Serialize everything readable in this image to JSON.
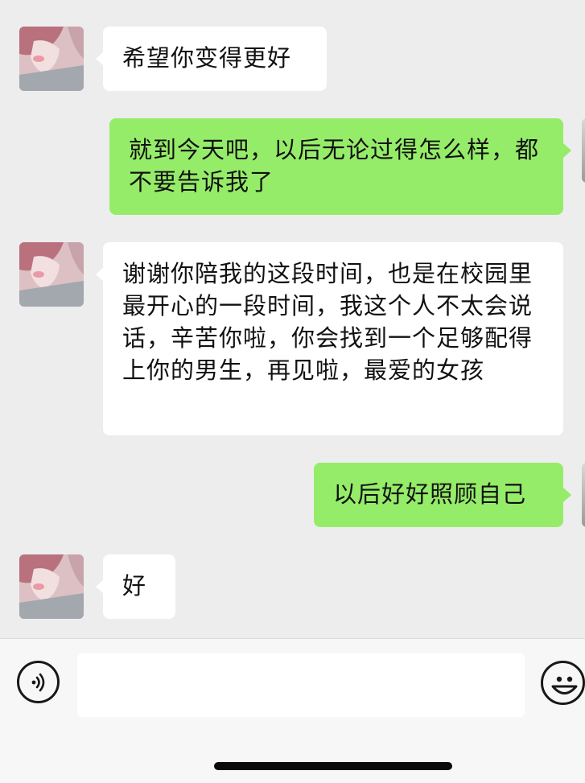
{
  "messages": [
    {
      "side": "received",
      "text": "希望你变得更好"
    },
    {
      "side": "sent",
      "text": "就到今天吧，以后无论过得怎么样，都不要告诉我了"
    },
    {
      "side": "received",
      "text": "谢谢你陪我的这段时间，也是在校园里最开心的一段时间，我这个人不太会说话，辛苦你啦，你会找到一个足够配得上你的男生，再见啦，最爱的女孩"
    },
    {
      "side": "sent",
      "text": "以后好好照顾自己"
    },
    {
      "side": "received",
      "text": "好"
    }
  ],
  "input_bar": {
    "text_value": "",
    "left_icon": "voice-icon",
    "right_icon": "emoji-icon"
  },
  "colors": {
    "background": "#ededed",
    "sent_bubble": "#95ec69",
    "received_bubble": "#ffffff"
  }
}
